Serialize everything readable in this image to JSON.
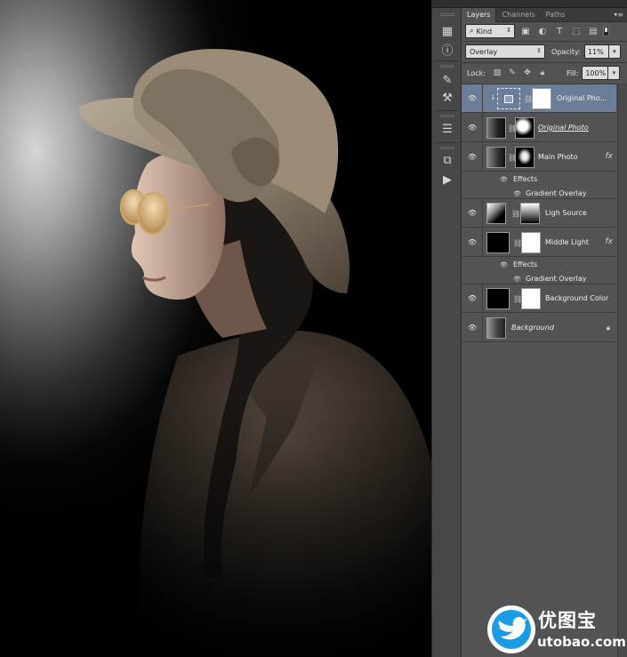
{
  "panel": {
    "tabs": [
      {
        "label": "Layers"
      },
      {
        "label": "Channels"
      },
      {
        "label": "Paths"
      }
    ],
    "filter_kind": "Kind",
    "blend_mode": "Overlay",
    "opacity_label": "Opacity:",
    "opacity_value": "11%",
    "lock_label": "Lock:",
    "fill_label": "Fill:",
    "fill_value": "100%",
    "layers": [
      {
        "name": "Original Pho...",
        "selected": true
      },
      {
        "name": "Original Photo"
      },
      {
        "name": "Main Photo",
        "effects_label": "Effects",
        "effect": "Gradient Overlay",
        "fx": "fx"
      },
      {
        "name": "Ligh Source"
      },
      {
        "name": "Middle Light",
        "effects_label": "Effects",
        "effect": "Gradient Overlay",
        "fx": "fx"
      },
      {
        "name": "Background Color"
      },
      {
        "name": "Background"
      }
    ]
  },
  "watermark": {
    "brand": "优图宝",
    "url": "utobao.com",
    "accent": "#1a9be6"
  },
  "colors": {
    "panel_bg": "#535353",
    "selected_layer": "#6b7e99",
    "canvas_glow": "#d6d6d6"
  }
}
